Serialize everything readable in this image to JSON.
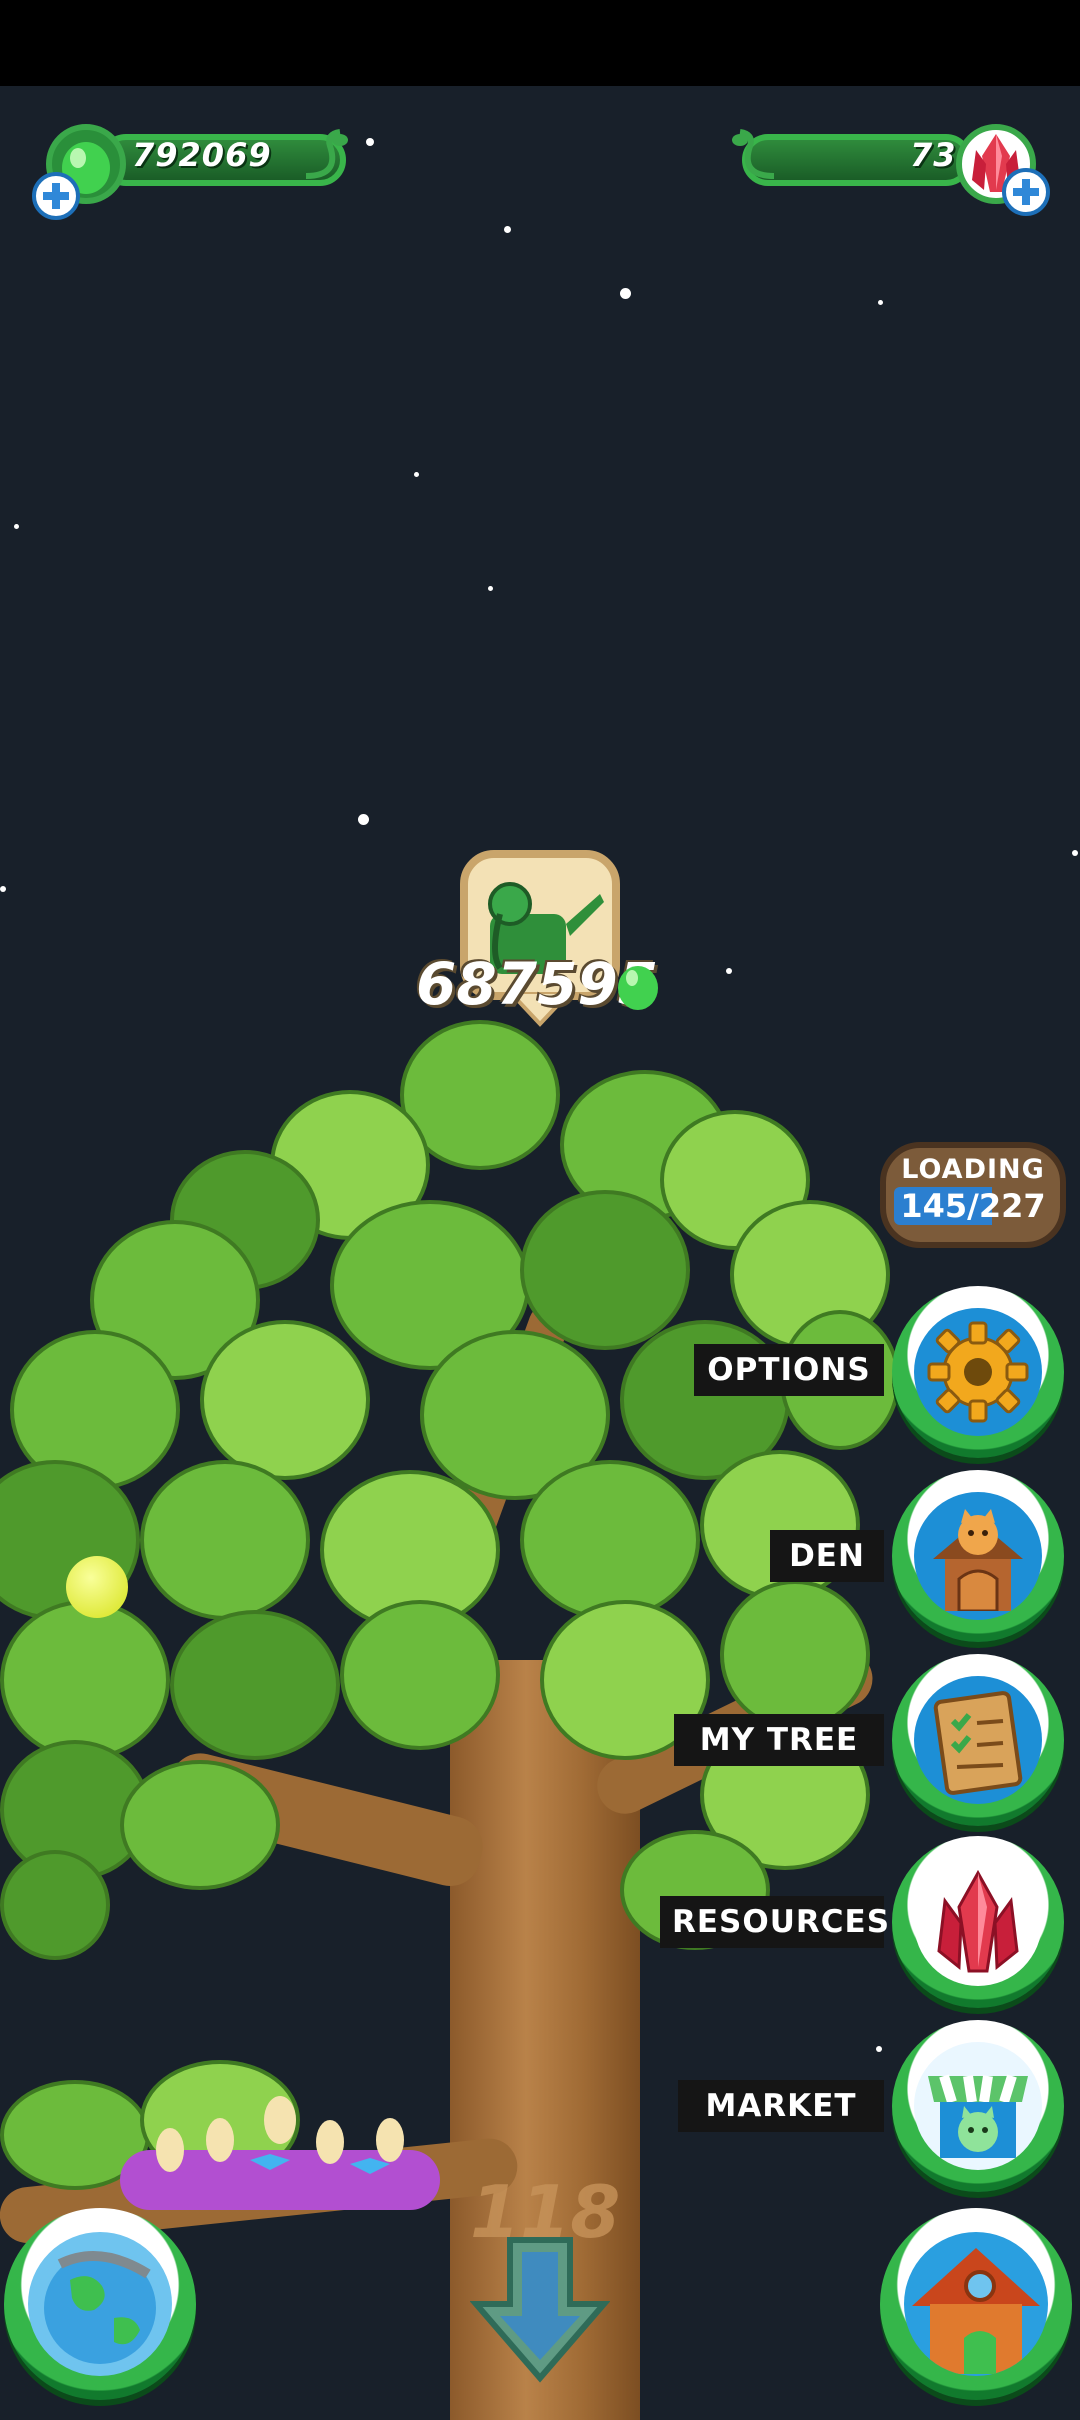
{
  "resources": {
    "green_currency": {
      "value": "792069",
      "icon": "green-gem-icon"
    },
    "red_gems": {
      "value": "73",
      "icon": "red-crystal-icon"
    }
  },
  "watering": {
    "amount": "687595",
    "icon": "watering-can-icon"
  },
  "loading": {
    "label": "LOADING",
    "progress": "145/227",
    "current": 145,
    "total": 227
  },
  "menu": {
    "options": {
      "label": "OPTIONS",
      "icon": "gear-icon"
    },
    "den": {
      "label": "DEN",
      "icon": "cat-house-icon"
    },
    "my_tree": {
      "label": "MY TREE",
      "icon": "checklist-board-icon"
    },
    "resources": {
      "label": "RESOURCES",
      "icon": "red-crystal-icon"
    },
    "market": {
      "label": "MARKET",
      "icon": "market-stall-icon"
    }
  },
  "bottom": {
    "globe": {
      "icon": "globe-icon"
    },
    "down": {
      "icon": "down-arrow-icon"
    },
    "home": {
      "icon": "home-icon"
    }
  },
  "tree_carving": "118",
  "colors": {
    "accent_green": "#35b64a",
    "blue": "#1d8fd6",
    "background": "#18202a"
  }
}
